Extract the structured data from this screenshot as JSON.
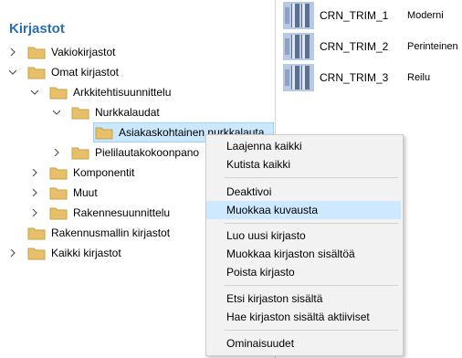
{
  "panel_title": "Kirjastot",
  "tree": [
    {
      "label": "Vakiokirjastot",
      "state": "collapsed"
    },
    {
      "label": "Omat kirjastot",
      "state": "expanded"
    },
    {
      "label": "Arkkitehtisuunnittelu",
      "state": "expanded"
    },
    {
      "label": "Nurkkalaudat",
      "state": "expanded"
    },
    {
      "label": "Asiakaskohtainen nurkkalauta",
      "state": "leaf",
      "selected": true
    },
    {
      "label": "Pielilautakokoonpano",
      "state": "collapsed"
    },
    {
      "label": "Komponentit",
      "state": "collapsed"
    },
    {
      "label": "Muut",
      "state": "collapsed"
    },
    {
      "label": "Rakennesuunnittelu",
      "state": "collapsed"
    },
    {
      "label": "Rakennusmallin kirjastot",
      "state": "leaf"
    },
    {
      "label": "Kaikki kirjastot",
      "state": "collapsed"
    }
  ],
  "library_items": [
    {
      "name": "CRN_TRIM_1",
      "type": "Moderni"
    },
    {
      "name": "CRN_TRIM_2",
      "type": "Perinteinen"
    },
    {
      "name": "CRN_TRIM_3",
      "type": "Reilu"
    }
  ],
  "context_menu": [
    {
      "label": "Laajenna kaikki"
    },
    {
      "label": "Kutista kaikki"
    },
    {
      "label": "Deaktivoi"
    },
    {
      "label": "Muokkaa kuvausta",
      "highlighted": true
    },
    {
      "label": "Luo uusi kirjasto"
    },
    {
      "label": "Muokkaa kirjaston sisältöä"
    },
    {
      "label": "Poista kirjasto"
    },
    {
      "label": "Etsi kirjaston sisältä"
    },
    {
      "label": "Hae kirjaston sisältä aktiiviset"
    },
    {
      "label": "Ominaisuudet"
    }
  ],
  "colors": {
    "title": "#2a6fb3",
    "folder": "#e8c06a",
    "selection": "#cce8ff",
    "menu_highlight": "#cde8ff"
  },
  "icons": {
    "folder": "folder-icon",
    "expand": "chevron-right-icon",
    "collapse": "chevron-down-icon",
    "library": "column-profile-icon"
  }
}
